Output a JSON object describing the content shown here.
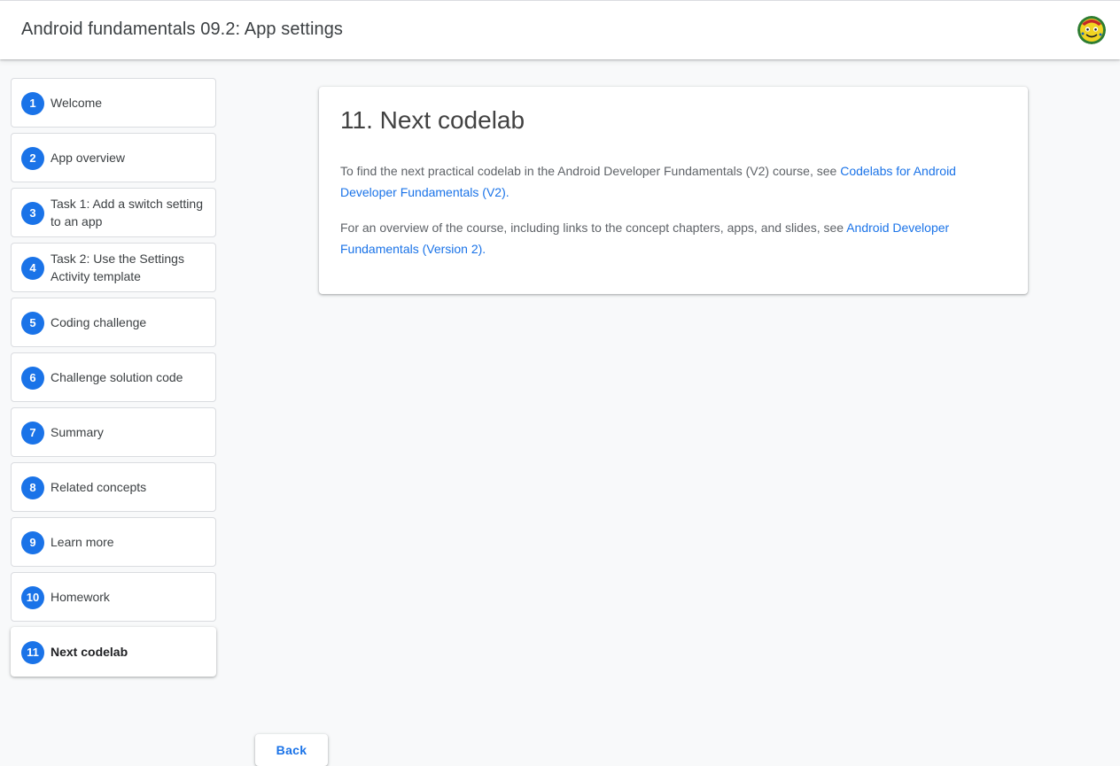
{
  "header": {
    "title": "Android fundamentals 09.2: App settings",
    "avatar_icon": "user-avatar-icon"
  },
  "sidebar": {
    "steps": [
      {
        "num": "1",
        "label": "Welcome",
        "active": false
      },
      {
        "num": "2",
        "label": "App overview",
        "active": false
      },
      {
        "num": "3",
        "label": "Task 1: Add a switch setting to an app",
        "active": false
      },
      {
        "num": "4",
        "label": "Task 2: Use the Settings Activity template",
        "active": false
      },
      {
        "num": "5",
        "label": "Coding challenge",
        "active": false
      },
      {
        "num": "6",
        "label": "Challenge solution code",
        "active": false
      },
      {
        "num": "7",
        "label": "Summary",
        "active": false
      },
      {
        "num": "8",
        "label": "Related concepts",
        "active": false
      },
      {
        "num": "9",
        "label": "Learn more",
        "active": false
      },
      {
        "num": "10",
        "label": "Homework",
        "active": false
      },
      {
        "num": "11",
        "label": "Next codelab",
        "active": true
      }
    ]
  },
  "main": {
    "heading": "11. Next codelab",
    "para1_text": "To find the next practical codelab in the Android Developer Fundamentals (V2) course, see ",
    "para1_link": "Codelabs for Android Developer Fundamentals (V2).",
    "para2_text": "For an overview of the course, including links to the concept chapters, apps, and slides, see ",
    "para2_link": "Android Developer Fundamentals (Version 2)."
  },
  "footer": {
    "back_label": "Back"
  },
  "colors": {
    "accent": "#1a73e8",
    "background": "#f8f9fa"
  }
}
